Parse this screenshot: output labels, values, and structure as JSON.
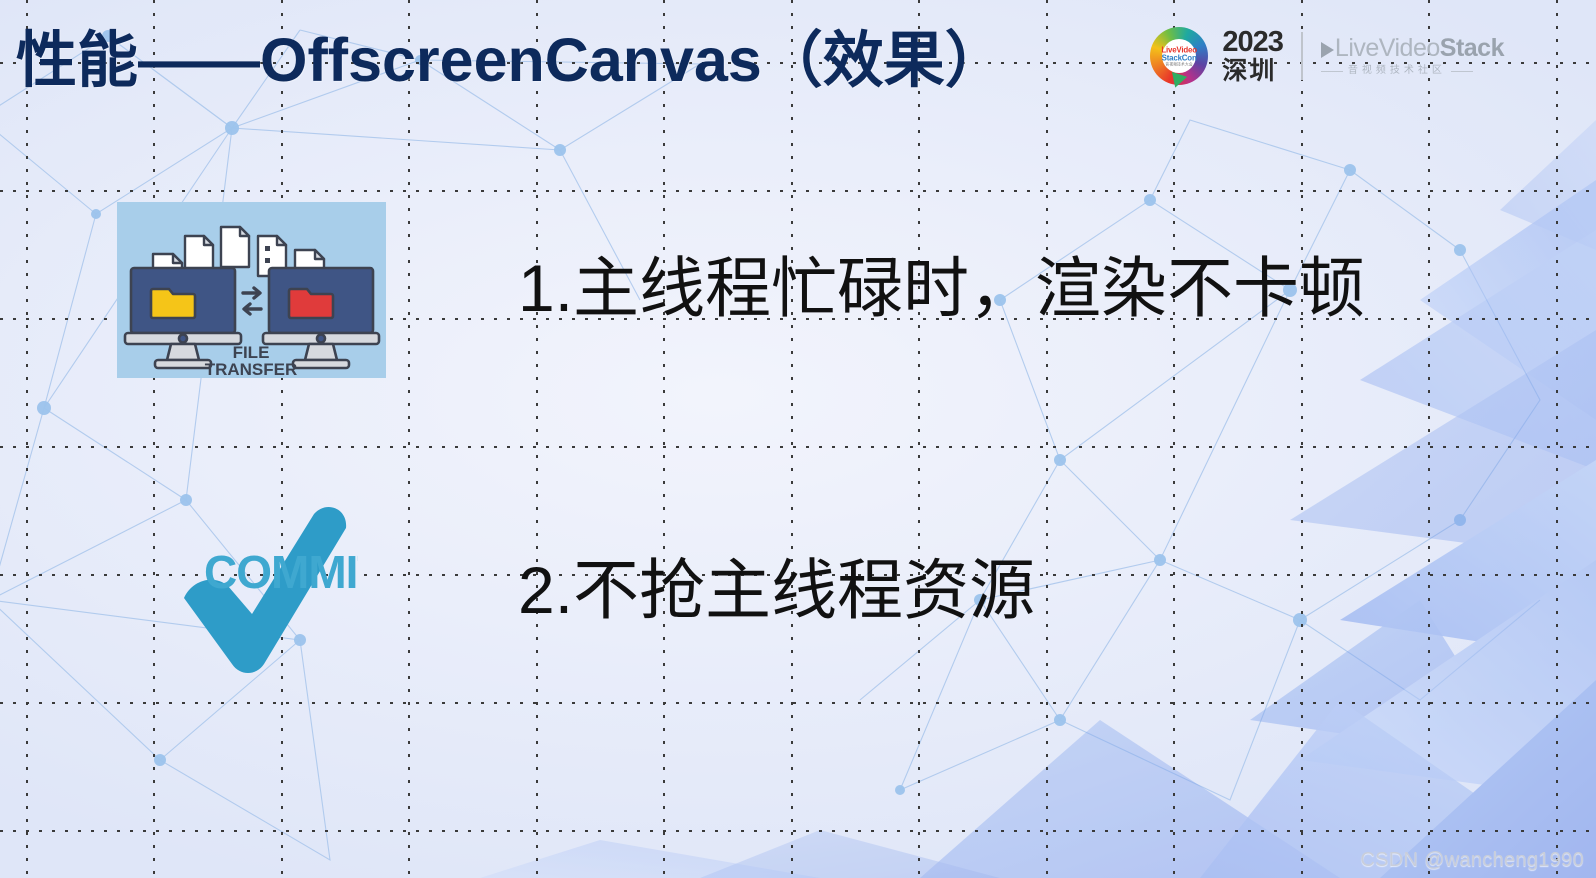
{
  "slide": {
    "title": "性能——OffscreenCanvas（效果）",
    "title_color": "#0D2A5C",
    "background_color": "#EDF0FA"
  },
  "header_logo": {
    "badge": {
      "line1": "LiveVideo",
      "line2": "StackCon",
      "line3": "音视频技术大会"
    },
    "year": "2023",
    "city": "深圳",
    "wordmark_main": "LiveVideo",
    "wordmark_bold": "Stack",
    "wordmark_sub": "音视频技术社区"
  },
  "bullets": [
    {
      "label": "1.主线程忙碌时，渲染不卡顿"
    },
    {
      "label": "2.不抢主线程资源"
    }
  ],
  "images": {
    "file_transfer": {
      "caption_line1": "FILE",
      "caption_line2": "TRANSFER",
      "background": "#A8CEEA",
      "monitor_color": "#3F5585",
      "folder_left_color": "#F5C518",
      "folder_right_color": "#E03B3B"
    },
    "commit": {
      "label": "COMMIT",
      "color": "#2E9CC8"
    }
  },
  "watermark": "CSDN @wancheng1990"
}
